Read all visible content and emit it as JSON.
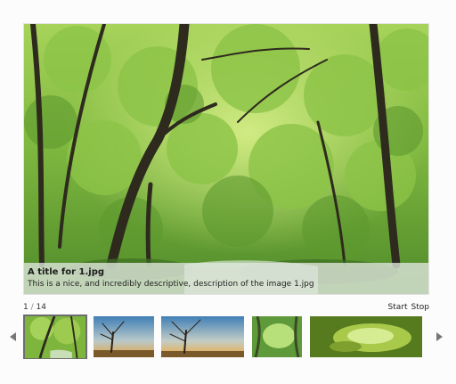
{
  "slide": {
    "title": "A title for 1.jpg",
    "description": "This is a nice, and incredibly descriptive, description of the image 1.jpg"
  },
  "counter": {
    "current": "1",
    "separator": "/",
    "total": "14"
  },
  "controls": {
    "start_label": "Start",
    "stop_label": "Stop"
  },
  "navigation": {
    "prev_icon": "triangle-left-icon",
    "next_icon": "triangle-right-icon"
  },
  "thumbnails": [
    {
      "subject": "green forest",
      "active": true
    },
    {
      "subject": "bare tree at sunset"
    },
    {
      "subject": "bare tree at sunset"
    },
    {
      "subject": "green forest tunnel"
    },
    {
      "subject": "green water drop"
    }
  ]
}
